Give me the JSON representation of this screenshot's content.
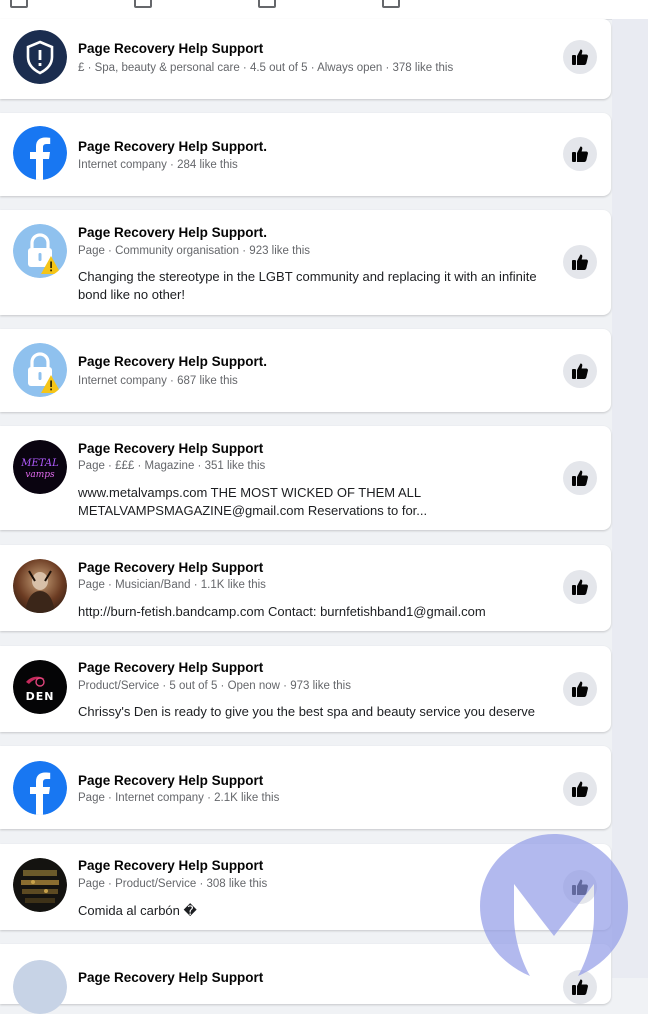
{
  "results": [
    {
      "name": "Page Recovery Help Support",
      "meta": "£ · Spa, beauty & personal care · 4.5 out of 5 · Always open · 378 like this",
      "desc": "",
      "avatar": "shield-logo-icon"
    },
    {
      "name": "Page Recovery Help Support.",
      "meta": "Internet company · 284 like this",
      "desc": "",
      "avatar": "facebook-logo-icon"
    },
    {
      "name": "Page Recovery Help Support.",
      "meta": "Page · Community organisation · 923 like this",
      "desc": "Changing the stereotype in the LGBT community and replacing it with an infinite bond like no other!",
      "avatar": "lock-warning-icon"
    },
    {
      "name": "Page Recovery Help Support.",
      "meta": "Internet company · 687 like this",
      "desc": "",
      "avatar": "lock-warning-icon"
    },
    {
      "name": "Page Recovery Help Support",
      "meta": "Page · £££ · Magazine · 351 like this",
      "desc": "www.metalvamps.com THE MOST WICKED OF THEM ALL METALVAMPSMAGAZINE@gmail.com Reservations to for...",
      "avatar": "metal-vamps-logo",
      "avatar_text": "METAL vamps"
    },
    {
      "name": "Page Recovery Help Support",
      "meta": "Page · Musician/Band · 1.1K like this",
      "desc": "http://burn-fetish.bandcamp.com Contact: burnfetishband1@gmail.com",
      "avatar": "band-photo"
    },
    {
      "name": "Page Recovery Help Support",
      "meta": "Product/Service · 5 out of 5 · Open now · 973 like this",
      "desc": "Chrissy's Den is ready to give you the best spa and beauty service you deserve",
      "avatar": "chrissys-den-logo",
      "avatar_text": "DEN"
    },
    {
      "name": "Page Recovery Help Support",
      "meta": "Page · Internet company · 2.1K like this",
      "desc": "",
      "avatar": "facebook-logo-icon"
    },
    {
      "name": "Page Recovery Help Support",
      "meta": "Page · Product/Service · 308 like this",
      "desc": "Comida al carbón �",
      "avatar": "food-photo"
    },
    {
      "name": "Page Recovery Help Support",
      "meta": "",
      "desc": "",
      "avatar": "lock-warning-icon"
    }
  ],
  "like_icon": "thumbs-up-icon",
  "colors": {
    "facebook_blue": "#1877f2",
    "meta_gray": "#65676b",
    "background": "#f0f2f5",
    "watermark": "#8f98e6"
  }
}
